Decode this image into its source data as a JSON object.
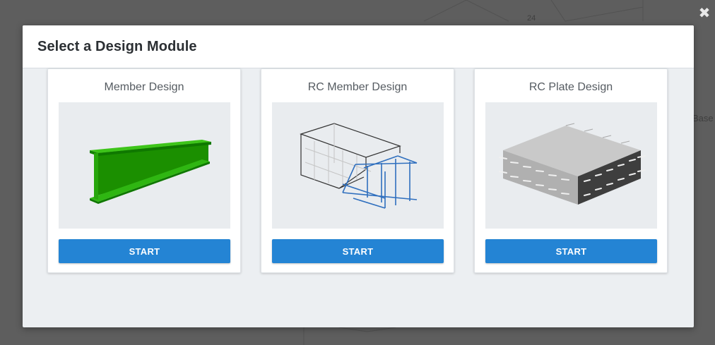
{
  "background": {
    "tick_label": "24",
    "side_text": "Base"
  },
  "close_icon": "close-icon",
  "modal": {
    "title": "Select a Design Module"
  },
  "modules": [
    {
      "title": "Member Design",
      "button_label": "START",
      "icon": "steel-i-beam-image"
    },
    {
      "title": "RC Member Design",
      "button_label": "START",
      "icon": "rc-member-cage-image"
    },
    {
      "title": "RC Plate Design",
      "button_label": "START",
      "icon": "rc-plate-slab-image"
    }
  ],
  "colors": {
    "accent": "#2484d4",
    "beam_green": "#1e9a00",
    "rebar_blue": "#2f6fbe"
  }
}
